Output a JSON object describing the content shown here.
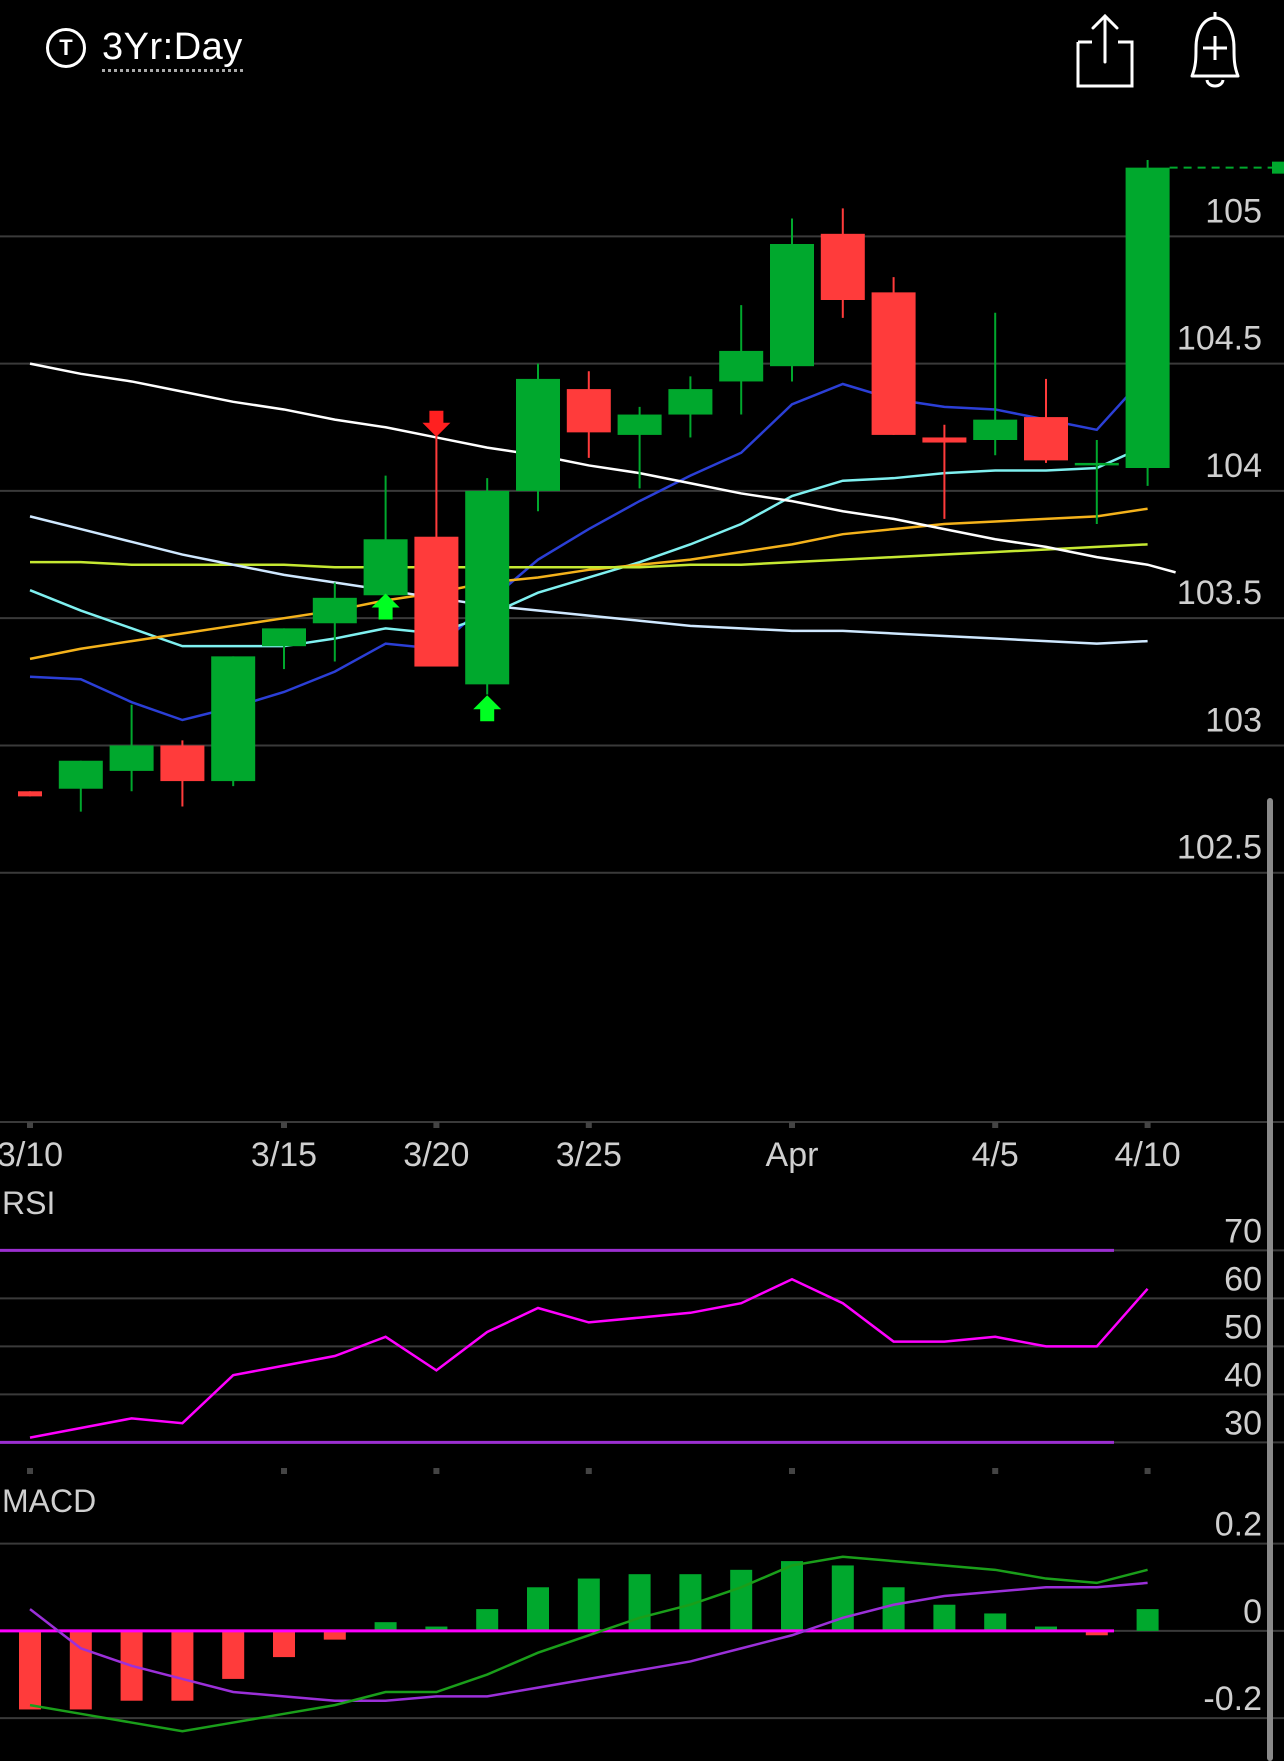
{
  "header": {
    "timeframe_icon_letter": "T",
    "timeframe_label": "3Yr:Day",
    "share_icon": "share-icon",
    "alert_icon": "add-alert-bell-icon"
  },
  "colors": {
    "up": "#00a82d",
    "down": "#ff3b3b",
    "grid": "#3a3a3a",
    "axis_text": "#cfcfcf",
    "rsi_line": "#ff00ff",
    "rsi_band": "#9b2fd0",
    "macd_line": "#1a9e1a",
    "macd_signal": "#9b30d9",
    "macd_zero": "#ff00ff"
  },
  "chart_data": [
    {
      "type": "candlestick",
      "x_tick_labels": [
        "3/10",
        "3/15",
        "3/20",
        "3/25",
        "Apr",
        "4/5",
        "4/10"
      ],
      "x_tick_index": [
        0,
        5,
        8,
        11,
        15,
        19,
        22
      ],
      "y_ticks": [
        102.5,
        103,
        103.5,
        104,
        104.5,
        105
      ],
      "ylim": [
        102.0,
        105.3
      ],
      "last_price": 105.27,
      "candles": [
        {
          "o": 102.82,
          "h": 102.82,
          "l": 102.8,
          "c": 102.8
        },
        {
          "o": 102.83,
          "h": 102.94,
          "l": 102.74,
          "c": 102.94
        },
        {
          "o": 102.9,
          "h": 103.16,
          "l": 102.82,
          "c": 103.0
        },
        {
          "o": 103.0,
          "h": 103.02,
          "l": 102.76,
          "c": 102.86
        },
        {
          "o": 102.86,
          "h": 103.35,
          "l": 102.84,
          "c": 103.35
        },
        {
          "o": 103.39,
          "h": 103.46,
          "l": 103.3,
          "c": 103.46
        },
        {
          "o": 103.48,
          "h": 103.64,
          "l": 103.33,
          "c": 103.58
        },
        {
          "o": 103.59,
          "h": 104.06,
          "l": 103.57,
          "c": 103.81
        },
        {
          "o": 103.82,
          "h": 104.27,
          "l": 103.31,
          "c": 103.31
        },
        {
          "o": 103.24,
          "h": 104.05,
          "l": 103.2,
          "c": 104.0
        },
        {
          "o": 104.0,
          "h": 104.5,
          "l": 103.92,
          "c": 104.44
        },
        {
          "o": 104.4,
          "h": 104.47,
          "l": 104.13,
          "c": 104.23
        },
        {
          "o": 104.22,
          "h": 104.33,
          "l": 104.01,
          "c": 104.3
        },
        {
          "o": 104.3,
          "h": 104.45,
          "l": 104.21,
          "c": 104.4
        },
        {
          "o": 104.43,
          "h": 104.73,
          "l": 104.3,
          "c": 104.55
        },
        {
          "o": 104.49,
          "h": 105.07,
          "l": 104.43,
          "c": 104.97
        },
        {
          "o": 105.01,
          "h": 105.11,
          "l": 104.68,
          "c": 104.75
        },
        {
          "o": 104.78,
          "h": 104.84,
          "l": 104.22,
          "c": 104.22
        },
        {
          "o": 104.21,
          "h": 104.26,
          "l": 103.89,
          "c": 104.19
        },
        {
          "o": 104.2,
          "h": 104.7,
          "l": 104.14,
          "c": 104.28
        },
        {
          "o": 104.29,
          "h": 104.44,
          "l": 104.11,
          "c": 104.12
        },
        {
          "o": 104.11,
          "h": 104.2,
          "l": 103.87,
          "c": 104.11
        },
        {
          "o": 104.09,
          "h": 105.3,
          "l": 104.02,
          "c": 105.27
        }
      ],
      "markers": [
        {
          "type": "sell",
          "index": 8,
          "price": 104.26
        },
        {
          "type": "buy",
          "index": 7,
          "price": 103.55
        },
        {
          "type": "buy",
          "index": 9,
          "price": 103.15
        }
      ],
      "overlays": [
        {
          "color": "#2b3fd6",
          "values": [
            103.27,
            103.26,
            103.17,
            103.1,
            103.15,
            103.21,
            103.29,
            103.4,
            103.38,
            103.56,
            103.73,
            103.85,
            103.96,
            104.06,
            104.15,
            104.34,
            104.42,
            104.36,
            104.33,
            104.32,
            104.28,
            104.24,
            104.46
          ]
        },
        {
          "color": "#7ff0f0",
          "values": [
            103.61,
            103.53,
            103.46,
            103.39,
            103.39,
            103.39,
            103.42,
            103.46,
            103.44,
            103.51,
            103.6,
            103.66,
            103.72,
            103.79,
            103.87,
            103.98,
            104.04,
            104.05,
            104.07,
            104.08,
            104.08,
            104.09,
            104.18
          ]
        },
        {
          "color": "#f4b21b",
          "values": [
            103.34,
            103.38,
            103.41,
            103.44,
            103.47,
            103.5,
            103.53,
            103.57,
            103.6,
            103.64,
            103.66,
            103.69,
            103.71,
            103.73,
            103.76,
            103.79,
            103.83,
            103.85,
            103.87,
            103.88,
            103.89,
            103.9,
            103.93
          ]
        },
        {
          "color": "#c5e832",
          "values": [
            103.72,
            103.72,
            103.71,
            103.71,
            103.71,
            103.71,
            103.7,
            103.7,
            103.7,
            103.7,
            103.7,
            103.7,
            103.7,
            103.71,
            103.71,
            103.72,
            103.73,
            103.74,
            103.75,
            103.76,
            103.77,
            103.78,
            103.79
          ]
        },
        {
          "color": "#cfe8ff",
          "values": [
            103.9,
            103.85,
            103.8,
            103.75,
            103.71,
            103.67,
            103.64,
            103.61,
            103.58,
            103.55,
            103.53,
            103.51,
            103.49,
            103.47,
            103.46,
            103.45,
            103.45,
            103.44,
            103.43,
            103.42,
            103.41,
            103.4,
            103.41
          ]
        },
        {
          "color": "#ffffff",
          "values": [
            104.5,
            104.46,
            104.43,
            104.39,
            104.35,
            104.32,
            104.28,
            104.25,
            104.21,
            104.17,
            104.14,
            104.1,
            104.07,
            104.03,
            103.99,
            103.96,
            103.92,
            103.89,
            103.85,
            103.81,
            103.78,
            103.74,
            103.71
          ]
        }
      ]
    },
    {
      "type": "line",
      "title": "RSI",
      "y_ticks": [
        30,
        40,
        50,
        60,
        70
      ],
      "ylim": [
        28,
        73
      ],
      "bands": [
        30,
        70
      ],
      "values": [
        31,
        33,
        35,
        34,
        44,
        46,
        48,
        52,
        45,
        53,
        58,
        55,
        56,
        57,
        59,
        64,
        59,
        51,
        51,
        52,
        50,
        50,
        62
      ]
    },
    {
      "type": "line",
      "title": "MACD",
      "y_ticks": [
        0.2,
        0,
        -0.2
      ],
      "ylim": [
        -0.25,
        0.3
      ],
      "macd": [
        -0.17,
        -0.19,
        -0.21,
        -0.23,
        -0.21,
        -0.19,
        -0.17,
        -0.14,
        -0.14,
        -0.1,
        -0.05,
        -0.01,
        0.03,
        0.06,
        0.1,
        0.15,
        0.17,
        0.16,
        0.15,
        0.14,
        0.12,
        0.11,
        0.14
      ],
      "signal": [
        0.05,
        -0.04,
        -0.08,
        -0.11,
        -0.14,
        -0.15,
        -0.16,
        -0.16,
        -0.15,
        -0.15,
        -0.13,
        -0.11,
        -0.09,
        -0.07,
        -0.04,
        -0.01,
        0.03,
        0.06,
        0.08,
        0.09,
        0.1,
        0.1,
        0.11
      ],
      "histogram": [
        -0.18,
        -0.18,
        -0.16,
        -0.16,
        -0.11,
        -0.06,
        -0.02,
        0.02,
        0.01,
        0.05,
        0.1,
        0.12,
        0.13,
        0.13,
        0.14,
        0.16,
        0.15,
        0.1,
        0.06,
        0.04,
        0.01,
        -0.01,
        0.05
      ]
    }
  ]
}
